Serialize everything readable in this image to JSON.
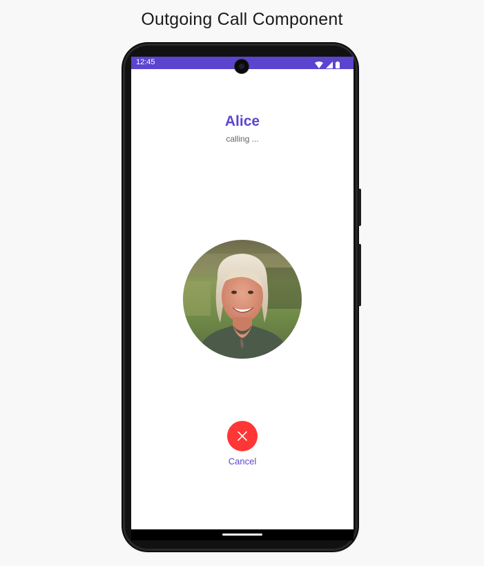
{
  "page": {
    "title": "Outgoing Call Component"
  },
  "status_bar": {
    "time": "12:45",
    "icons": [
      "wifi-icon",
      "cellular-signal-icon",
      "battery-icon"
    ],
    "color": "#5b45cf"
  },
  "call": {
    "caller_name": "Alice",
    "status": "calling ...",
    "avatar": "caller-avatar-photo",
    "cancel_label": "Cancel",
    "cancel_color": "#fe3636",
    "accent_color": "#5b45cf"
  }
}
